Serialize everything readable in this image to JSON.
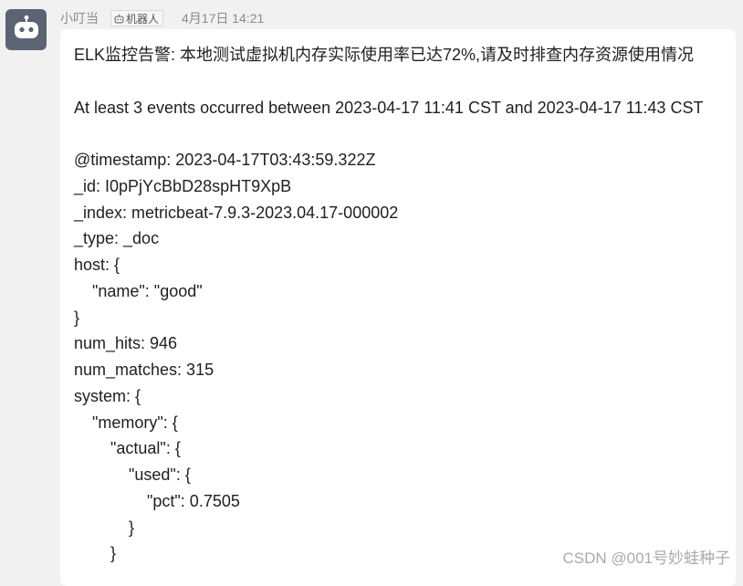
{
  "sender": {
    "name": "小叮当",
    "badge_label": "机器人",
    "timestamp": "4月17日 14:21",
    "avatar_icon": "robot-icon",
    "badge_icon": "robot-icon"
  },
  "message": {
    "lines": [
      "ELK监控告警: 本地测试虚拟机内存实际使用率已达72%,请及时排查内存资源使用情况",
      "",
      "At least 3 events occurred between 2023-04-17 11:41 CST and 2023-04-17 11:43 CST",
      "",
      "@timestamp: 2023-04-17T03:43:59.322Z",
      "_id: I0pPjYcBbD28spHT9XpB",
      "_index: metricbeat-7.9.3-2023.04.17-000002",
      "_type: _doc",
      "host: {",
      "    \"name\": \"good\"",
      "}",
      "num_hits: 946",
      "num_matches: 315",
      "system: {",
      "    \"memory\": {",
      "        \"actual\": {",
      "            \"used\": {",
      "                \"pct\": 0.7505",
      "            }",
      "        }"
    ]
  },
  "watermark": "CSDN @001号妙蛙种子",
  "colors": {
    "background": "#f1f1f1",
    "bubble": "#ffffff",
    "avatar": "#5b6472",
    "meta_text": "#8a8a8a",
    "body_text": "#1f1f1f"
  }
}
